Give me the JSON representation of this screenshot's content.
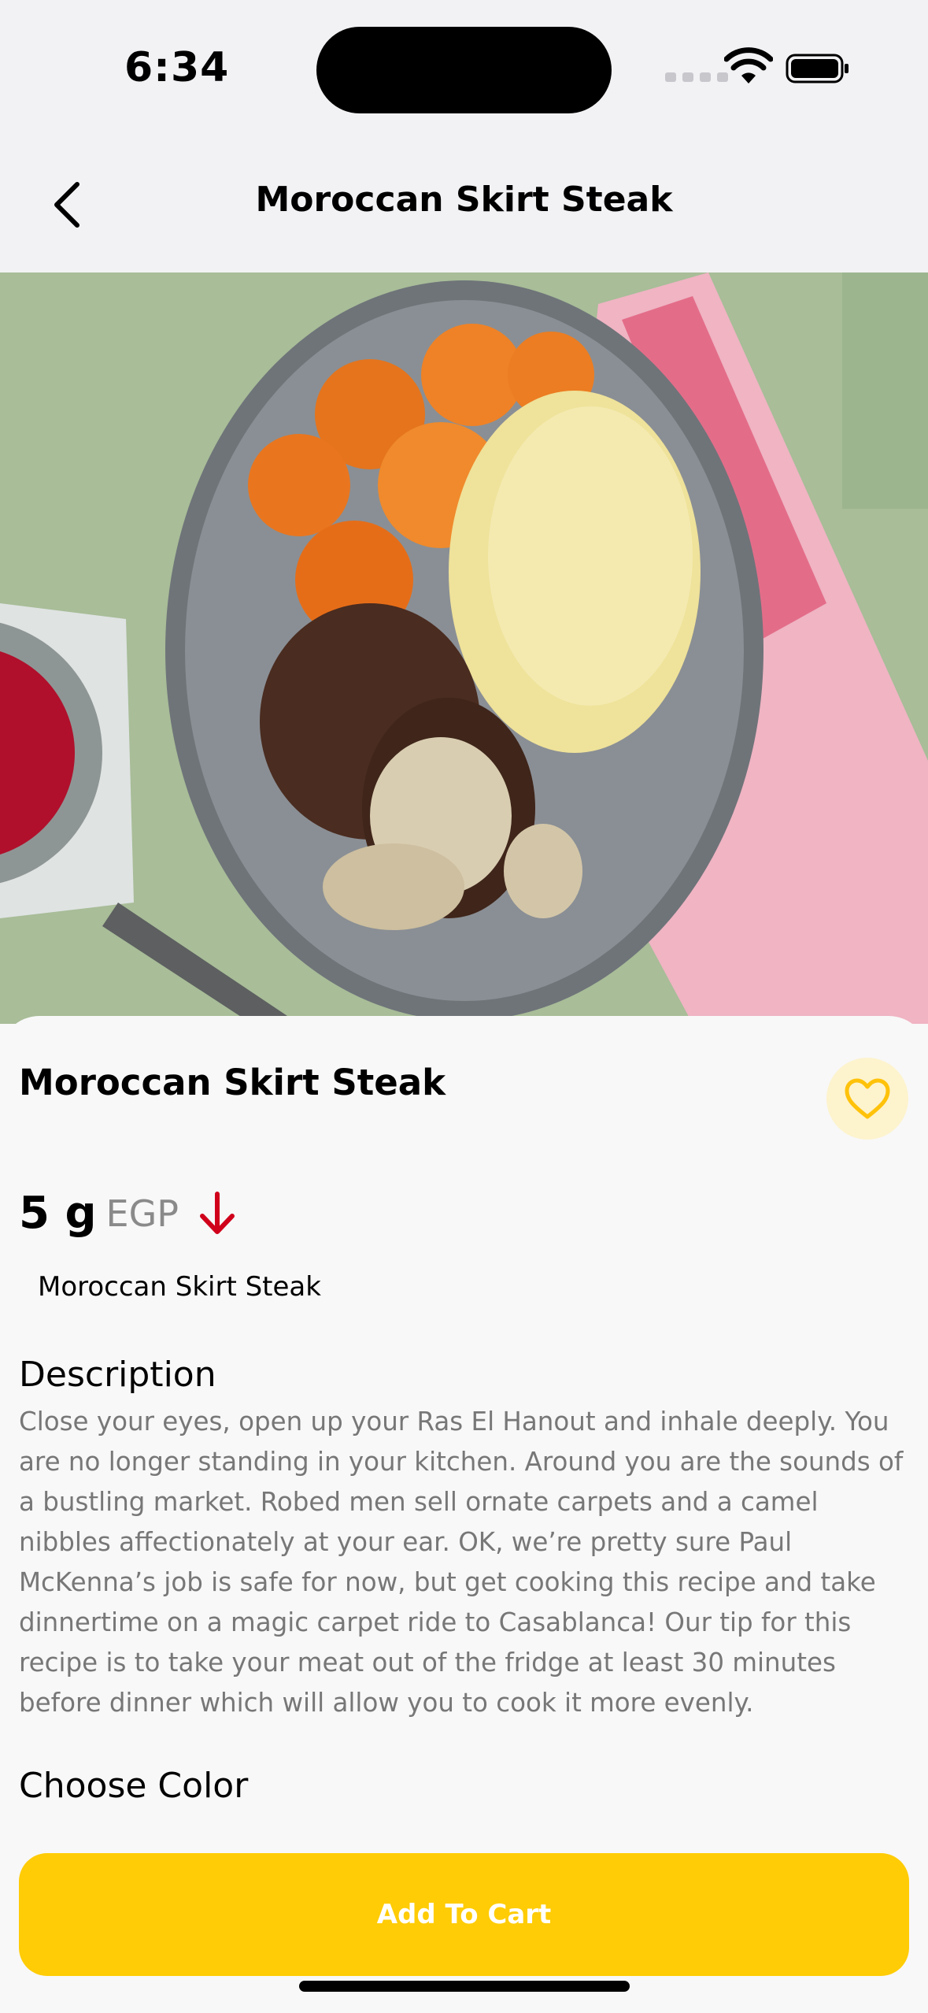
{
  "status_bar": {
    "time": "6:34"
  },
  "nav": {
    "title": "Moroccan Skirt Steak",
    "back_icon": "chevron-left-icon"
  },
  "product": {
    "title": "Moroccan Skirt Steak",
    "price_value": "5 g",
    "price_currency": "EGP",
    "price_trend_icon": "arrow-down-icon",
    "subtitle": "Moroccan Skirt Steak",
    "favorite_icon": "heart-icon"
  },
  "description": {
    "heading": "Description",
    "text": "Close your eyes, open up your Ras El Hanout and inhale deeply. You are no longer standing in your kitchen. Around you are the sounds of a bustling market. Robed men sell ornate carpets and a camel nibbles affectionately at your ear.  OK, we’re pretty sure Paul McKenna’s job is safe for now, but get cooking this recipe and take dinnertime on a magic carpet ride to Casablanca! Our tip for this recipe is to take your meat out of the fridge at least 30 minutes before dinner which will allow you to cook it more evenly."
  },
  "color_section": {
    "heading": "Choose Color"
  },
  "cart": {
    "label": "Add To Cart"
  },
  "colors": {
    "accent": "#FFCC05",
    "trend_down": "#D0021B",
    "favorite_bg": "#FDF3CD"
  }
}
